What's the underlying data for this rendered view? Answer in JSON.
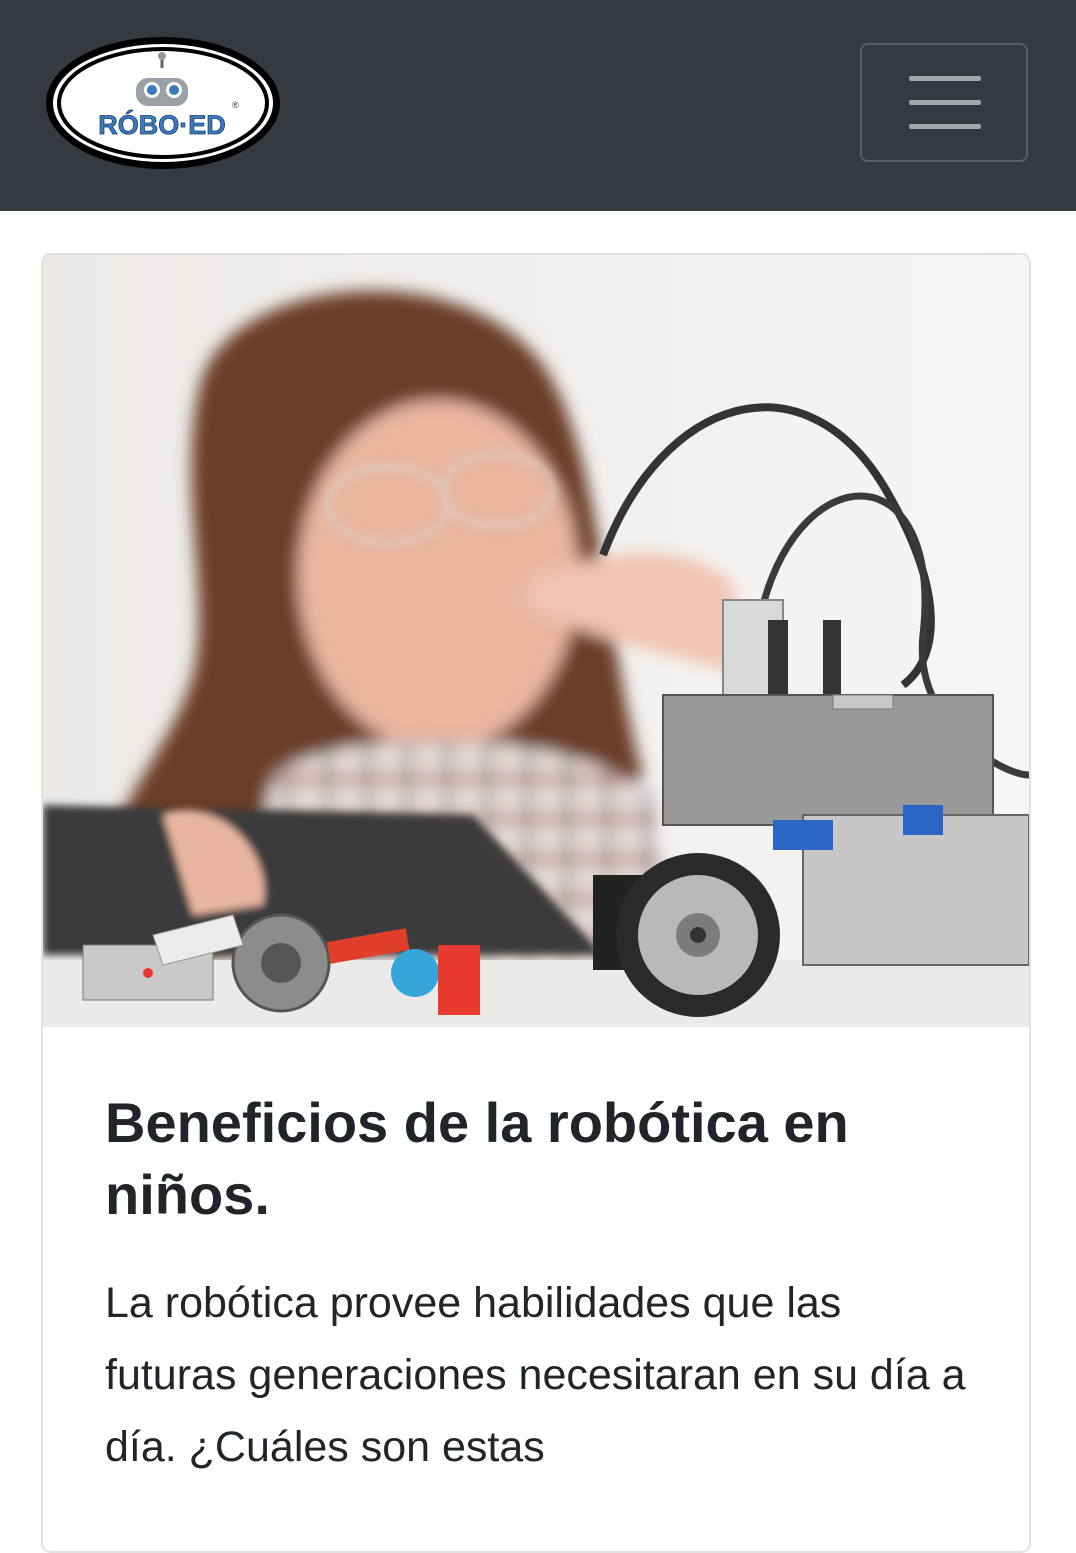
{
  "navbar": {
    "logo_text": "RÓBO·ED",
    "logo_registered": "®",
    "menu_icon": "hamburger-menu-icon"
  },
  "article": {
    "image_description_icon": "photo-girl-robotics",
    "title": "Beneficios de la robótica en niños.",
    "text": "La robótica provee habilidades que las futuras generaciones necesitaran en su día a día. ¿Cuáles son estas"
  },
  "colors": {
    "navbar_bg": "#343a40",
    "text": "#212529",
    "logo_blue": "#3a7bbf"
  }
}
